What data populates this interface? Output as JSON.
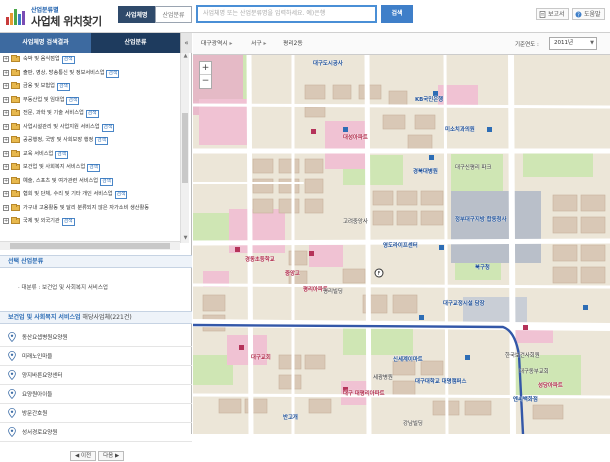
{
  "header": {
    "logo_sub": "산업분류별",
    "logo_title": "사업체 위치찾기",
    "tabs": [
      "사업체명",
      "산업분류"
    ],
    "search_placeholder": "사업체명 또는 산업분류명을 입력하세요. 예)은행",
    "search_label": "검색",
    "report_label": "보고서",
    "help_label": "도움말"
  },
  "sidebar": {
    "tabs": [
      "사업체명 검색결과",
      "산업분류"
    ],
    "collapse": "«",
    "tree": [
      {
        "label": "숙박 및 음식점업",
        "badge": "검색"
      },
      {
        "label": "출판, 영상, 방송통신 및 정보서비스업",
        "badge": "검색"
      },
      {
        "label": "금융 및 보험업",
        "badge": "검색"
      },
      {
        "label": "부동산업 및 임대업",
        "badge": "검색"
      },
      {
        "label": "전문, 과학 및 기술 서비스업",
        "badge": "검색"
      },
      {
        "label": "사업시설관리 및 사업지원 서비스업",
        "badge": "검색"
      },
      {
        "label": "공공행정, 국방 및 사회보장 행정",
        "badge": "검색"
      },
      {
        "label": "교육 서비스업",
        "badge": "검색"
      },
      {
        "label": "보건업 및 사회복지 서비스업",
        "badge": "검색"
      },
      {
        "label": "예술, 스포츠 및 여가관련 서비스업",
        "badge": "검색"
      },
      {
        "label": "협회 및 단체, 수리 및 기타 개인 서비스업",
        "badge": "검색"
      },
      {
        "label": "가구내 고용활동 및 달리 분류되지 않은 자가소비 생산활동",
        "badge": ""
      },
      {
        "label": "국제 및 외국기관",
        "badge": "검색"
      }
    ],
    "selected_head": "선택 산업분류",
    "selected_path": "· 대분류 : 보건업 및 사회복지 서비스업",
    "result_category": "보건업 및 사회복지 서비스업",
    "result_count": " 해당사업체(221건)",
    "results": [
      "동산요셉병원요양원",
      "미래노인마을",
      "양지바른요양센터",
      "요양원아이들",
      "방문간호원",
      "성서경로요양원"
    ],
    "pager": {
      "prev": "◀ 이전",
      "next": "다음 ▶"
    }
  },
  "toolbar": {
    "crumbs": [
      "대구광역시",
      "서구",
      "평리2동"
    ],
    "year_label": "기준연도 :",
    "year_value": "2011년"
  },
  "map": {
    "zoom_in": "+",
    "zoom_out": "−",
    "labels": [
      {
        "t": "대구도시공사",
        "c": "blue"
      },
      {
        "t": "KB국민은행",
        "c": "blue"
      },
      {
        "t": "미소치과의원",
        "c": "blue"
      },
      {
        "t": "대성아파트",
        "c": "red"
      },
      {
        "t": "경북대병원",
        "c": "blue"
      },
      {
        "t": "대구신평리 파크",
        "c": ""
      },
      {
        "t": "정부대구지방 합동청사",
        "c": "blue"
      },
      {
        "t": "고려중앙사",
        "c": ""
      },
      {
        "t": "경동초등학교",
        "c": "red"
      },
      {
        "t": "북구청",
        "c": "blue"
      },
      {
        "t": "영도라이프센터",
        "c": "blue"
      },
      {
        "t": "중앙고",
        "c": "red"
      },
      {
        "t": "평리아파트",
        "c": "red"
      },
      {
        "t": "대구교회",
        "c": "red"
      },
      {
        "t": "대구교정시설 담장",
        "c": "blue"
      },
      {
        "t": "신세계이마트",
        "c": "blue"
      },
      {
        "t": "세광병원",
        "c": ""
      },
      {
        "t": "대구 대평리아파트",
        "c": "red"
      },
      {
        "t": "대구대학교 대명캠퍼스",
        "c": "blue"
      },
      {
        "t": "한국보건사회원",
        "c": ""
      },
      {
        "t": "대구동부교회",
        "c": ""
      },
      {
        "t": "엔씨백화점",
        "c": "blue"
      },
      {
        "t": "성당아파트",
        "c": "red"
      },
      {
        "t": "강남빌딩",
        "c": ""
      },
      {
        "t": "반고개",
        "c": "blue"
      },
      {
        "t": "평리빌딩",
        "c": ""
      }
    ]
  },
  "colors": {
    "accent": "#3f7fc9",
    "nav_dark": "#1e3b5e",
    "badge": "#2d6db5"
  }
}
